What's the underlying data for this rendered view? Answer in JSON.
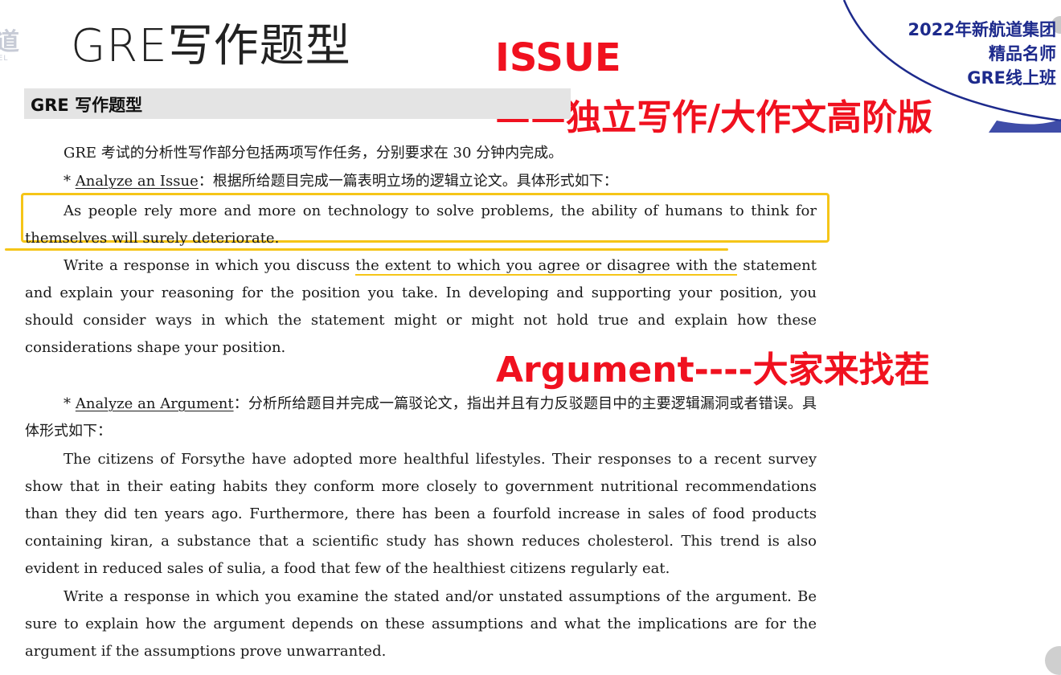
{
  "logo": {
    "mark": "道",
    "caption": "IEL"
  },
  "header": {
    "title": "GRE写作题型",
    "issue_label": "ISSUE",
    "issue_subtitle": "——独立写作/大作文高阶版",
    "banner_line1": "2022年新航道集团",
    "banner_line2": "精品名师",
    "banner_line3": "GRE线上班",
    "accent_color": "#f0111f",
    "banner_color": "#1d2a8c",
    "highlight_color": "#f5c518"
  },
  "section": {
    "heading": "GRE 写作题型"
  },
  "body": {
    "intro": "GRE 考试的分析性写作部分包括两项写作任务，分别要求在 30 分钟内完成。",
    "issue_marker": "* ",
    "issue_task_name": "Analyze an Issue",
    "issue_task_desc": "：根据所给题目完成一篇表明立场的逻辑立论文。具体形式如下：",
    "issue_prompt": "As people rely more and more on technology to solve problems, the ability of humans to think for themselves will surely deteriorate.",
    "issue_instr_a": "Write a response in which you discuss ",
    "issue_instr_b": "the extent to which you agree or disagree with the",
    "issue_instr_c": " statement and explain your reasoning for the position you take. In developing and supporting your position, you should consider ways in which the statement might or might not hold true and explain how these considerations shape your position.",
    "argument_label": "Argument----大家来找茬",
    "argument_marker": "* ",
    "argument_task_name": "Analyze an Argument",
    "argument_task_desc": "：分析所给题目并完成一篇驳论文，指出并且有力反驳题目中的主要逻辑漏洞或者错误。具体形式如下：",
    "argument_prompt": "The citizens of Forsythe have adopted more healthful lifestyles. Their responses to a recent survey show that in their eating habits they conform more closely to government nutritional recommendations than they did ten years ago. Furthermore, there has been a fourfold increase in sales of food products containing kiran, a substance that a scientific study has shown reduces cholesterol. This trend is also evident in reduced sales of sulia, a food that few of the healthiest citizens regularly eat.",
    "argument_instr": "Write a response in which you examine the stated and/or unstated assumptions of the argument. Be sure to explain how the argument depends on these assumptions and what the implications are for the argument if the assumptions prove unwarranted."
  }
}
